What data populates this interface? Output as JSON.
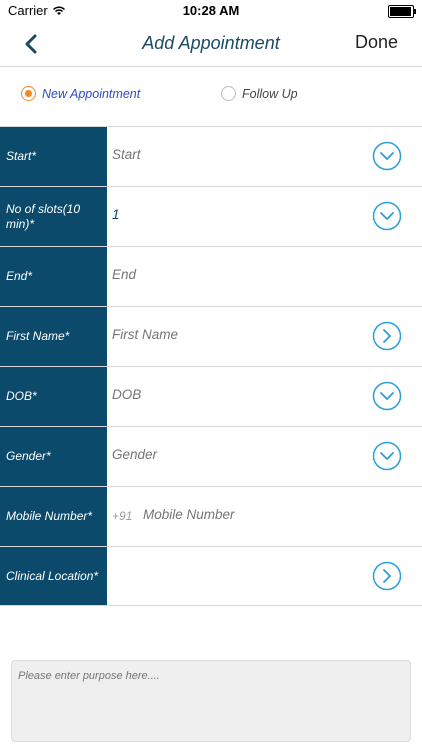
{
  "status_bar": {
    "carrier": "Carrier",
    "time": "10:28 AM",
    "battery_level": 0.95
  },
  "nav": {
    "title": "Add Appointment",
    "done_label": "Done"
  },
  "appointment_type": {
    "options": [
      {
        "label": "New Appointment",
        "selected": true
      },
      {
        "label": "Follow Up",
        "selected": false
      }
    ]
  },
  "form": {
    "rows": [
      {
        "label": "Start*",
        "placeholder": "Start",
        "value": "",
        "icon": "chevron-down-icon"
      },
      {
        "label": "No of slots(10 min)*",
        "placeholder": "",
        "value": "1",
        "icon": "chevron-down-icon"
      },
      {
        "label": "End*",
        "placeholder": "End",
        "value": "",
        "icon": ""
      },
      {
        "label": "First Name*",
        "placeholder": "First Name",
        "value": "",
        "icon": "chevron-right-icon"
      },
      {
        "label": "DOB*",
        "placeholder": "DOB",
        "value": "",
        "icon": "chevron-down-icon"
      },
      {
        "label": "Gender*",
        "placeholder": "Gender",
        "value": "",
        "icon": "chevron-down-icon"
      },
      {
        "label": "Mobile Number*",
        "prefix": "+91",
        "placeholder": "Mobile Number",
        "value": ""
      },
      {
        "label": "Clinical Location*",
        "placeholder": "",
        "value": "",
        "icon": "chevron-right-icon"
      }
    ]
  },
  "purpose": {
    "placeholder": "Please enter purpose here...."
  },
  "colors": {
    "accent": "#2a9fd8",
    "label_bg": "#0c4a6b",
    "radio_selected": "#f08a24"
  }
}
